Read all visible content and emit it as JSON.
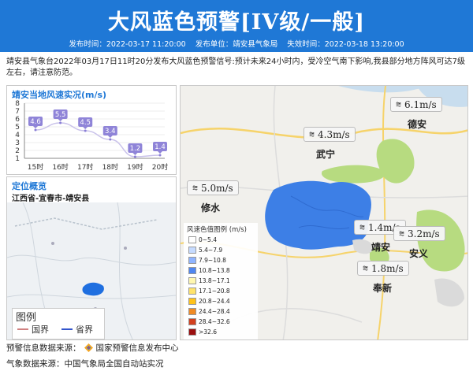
{
  "header": {
    "title": "大风蓝色预警[IV级/一般]",
    "publish_time": "发布时间：2022-03-17 11:20:00",
    "publisher": "发布单位：靖安县气象局",
    "expire_time": "失效时间：2022-03-18 13:20:00"
  },
  "description": "靖安县气象台2022年03月17日11时20分发布大风蓝色预警信号:预计未来24小时内，受冷空气南下影响,我县部分地方阵风可达7级左右，请注意防范。",
  "wind_panel": {
    "title": "靖安当地风速实况(m/s)"
  },
  "chart_data": {
    "type": "line",
    "title": "靖安当地风速实况(m/s)",
    "categories": [
      "15时",
      "16时",
      "17时",
      "18时",
      "19时",
      "20时"
    ],
    "values": [
      4.6,
      5.5,
      4.5,
      3.4,
      1.2,
      1.4
    ],
    "ylim": [
      1,
      8
    ],
    "yticks": [
      1,
      2,
      3,
      4,
      5,
      6,
      7,
      8
    ],
    "data_labels": [
      "4.6",
      "5.5",
      "4.5",
      "3.4",
      "1.2",
      "1.4"
    ]
  },
  "location_panel": {
    "title": "定位概览",
    "region": "江西省-宜春市-靖安县",
    "legend_title": "图例",
    "legend_items": [
      {
        "label": "国界",
        "color": "#d08080"
      },
      {
        "label": "省界",
        "color": "#3355cc"
      }
    ]
  },
  "map": {
    "wind_readings": [
      {
        "value": "6.1m/s",
        "place": "德安"
      },
      {
        "value": "4.3m/s",
        "place": "武宁"
      },
      {
        "value": "5.0m/s",
        "place": "修水"
      },
      {
        "value": "1.4m/s",
        "place": "靖安"
      },
      {
        "value": "3.2m/s",
        "place": "安义"
      },
      {
        "value": "1.8m/s",
        "place": "奉新"
      }
    ],
    "wind_icon": "wind-icon",
    "speed_legend_title": "风速色值图例 (m/s)",
    "speed_legend": [
      {
        "range": "0~5.4",
        "color": "#ffffff"
      },
      {
        "range": "5.4~7.9",
        "color": "#c6dbff"
      },
      {
        "range": "7.9~10.8",
        "color": "#8fb4ff"
      },
      {
        "range": "10.8~13.8",
        "color": "#4f86f0"
      },
      {
        "range": "13.8~17.1",
        "color": "#fff7b0"
      },
      {
        "range": "17.1~20.8",
        "color": "#ffe36b"
      },
      {
        "range": "20.8~24.4",
        "color": "#ffc21a"
      },
      {
        "range": "24.4~28.4",
        "color": "#f08a24"
      },
      {
        "range": "28.4~32.6",
        "color": "#d2401e"
      },
      {
        "range": ">32.6",
        "color": "#9a0f0f"
      }
    ],
    "region_color": "#3d7fe6",
    "green_color": "#b7db80"
  },
  "footer": {
    "warning_source": "预警信息数据来源：",
    "warning_source_name": "国家预警信息发布中心",
    "weather_source": "气象数据来源：中国气象局全国自动站实况"
  }
}
